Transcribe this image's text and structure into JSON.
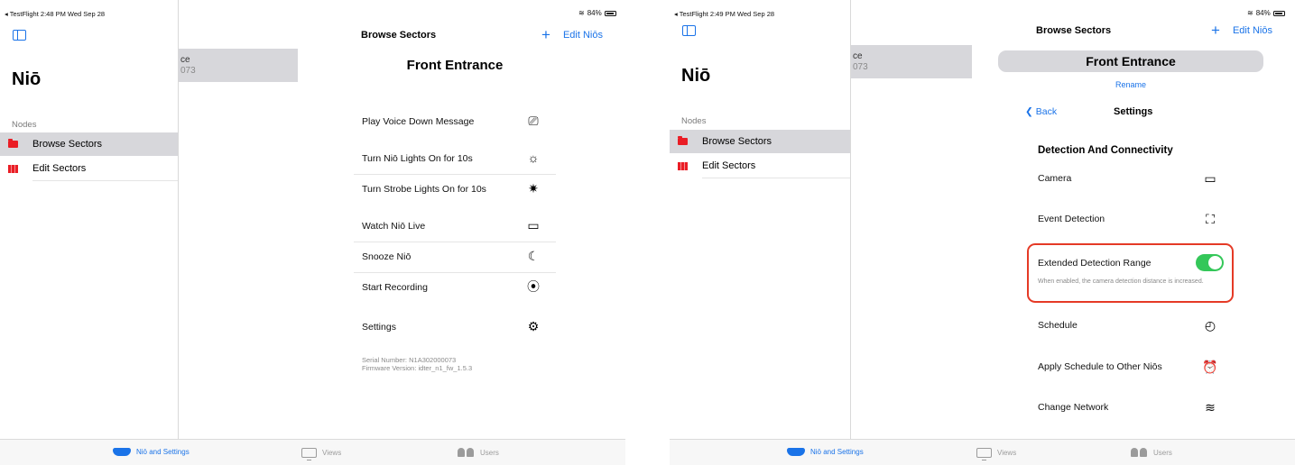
{
  "left": {
    "status": {
      "left": "◂ TestFlight  2:48 PM  Wed Sep 28",
      "battery": "84%"
    },
    "sidebar": {
      "title": "Niō",
      "section": "Nodes",
      "items": [
        {
          "label": "Browse Sectors",
          "icon": "folder-icon"
        },
        {
          "label": "Edit Sectors",
          "icon": "map-icon"
        }
      ],
      "peek": {
        "line1": "ce",
        "line2": "073"
      }
    },
    "detail": {
      "nav_title": "Browse Sectors",
      "nav_action": "Edit Niōs",
      "device_title": "Front Entrance",
      "rows": [
        {
          "label": "Play Voice Down Message",
          "icon": "!"
        },
        {
          "label": "Turn Niō Lights On for 10s",
          "icon": "☼"
        },
        {
          "label": "Turn Strobe Lights On for 10s",
          "icon": "✷"
        },
        {
          "label": "Watch Niō Live",
          "icon": "▭"
        },
        {
          "label": "Snooze Niō",
          "icon": "☾"
        },
        {
          "label": "Start Recording",
          "icon": "⦿"
        },
        {
          "label": "Settings",
          "icon": "⚙"
        }
      ],
      "serial": "Serial Number: N1A302000073",
      "firmware": "Firmware Version: idter_n1_fw_1.5.3"
    },
    "tabs": [
      {
        "label": "Niō and Settings"
      },
      {
        "label": "Views"
      },
      {
        "label": "Users"
      }
    ]
  },
  "right": {
    "status": {
      "left": "◂ TestFlight  2:49 PM  Wed Sep 28",
      "battery": "84%"
    },
    "sidebar": {
      "title": "Niō",
      "section": "Nodes",
      "items": [
        {
          "label": "Browse Sectors",
          "icon": "folder-icon"
        },
        {
          "label": "Edit Sectors",
          "icon": "map-icon"
        }
      ],
      "peek": {
        "line1": "ce",
        "line2": "073"
      }
    },
    "detail": {
      "nav_title": "Browse Sectors",
      "nav_action": "Edit Niōs",
      "device_title": "Front Entrance",
      "rename": "Rename",
      "back": "Back",
      "settings_title": "Settings",
      "section_title": "Detection And Connectivity",
      "rows": [
        {
          "label": "Camera",
          "icon": "camera-icon"
        },
        {
          "label": "Event Detection",
          "icon": "frame-icon"
        },
        {
          "label": "Extended Detection Range",
          "icon": "toggle",
          "toggle_on": true,
          "description": "When enabled, the camera detection distance is increased."
        },
        {
          "label": "Schedule",
          "icon": "clock-icon"
        },
        {
          "label": "Apply Schedule to Other Niōs",
          "icon": "alarm-icon"
        },
        {
          "label": "Change Network",
          "icon": "wifi-icon"
        }
      ]
    },
    "tabs": [
      {
        "label": "Niō and Settings"
      },
      {
        "label": "Views"
      },
      {
        "label": "Users"
      }
    ]
  },
  "colors": {
    "accent": "#1a73e8",
    "toggle_on": "#34c759",
    "highlight": "#e53a26",
    "selected_row": "#d7d7db"
  }
}
